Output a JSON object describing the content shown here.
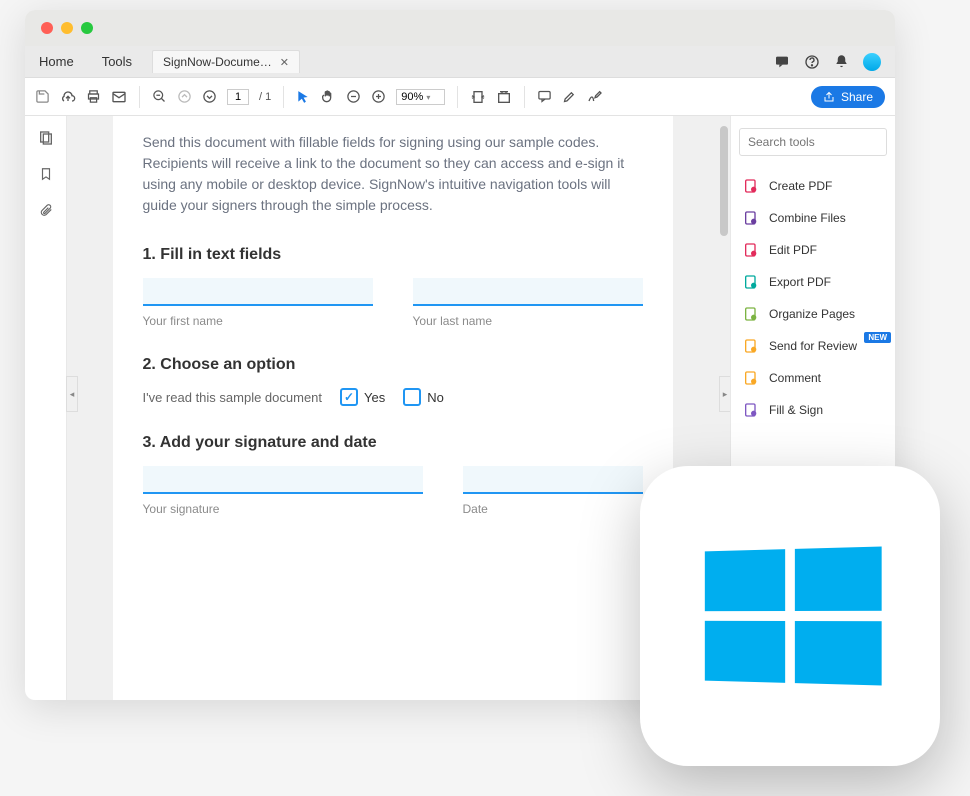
{
  "tabs": {
    "home": "Home",
    "tools": "Tools",
    "document": "SignNow-Docume…"
  },
  "toolbar": {
    "page_current": "1",
    "page_total": "/ 1",
    "zoom": "90%",
    "share": "Share"
  },
  "search": {
    "placeholder": "Search tools"
  },
  "tools_list": [
    {
      "label": "Create PDF",
      "color": "#e22b5b"
    },
    {
      "label": "Combine Files",
      "color": "#6b3fa0"
    },
    {
      "label": "Edit PDF",
      "color": "#e22b5b"
    },
    {
      "label": "Export PDF",
      "color": "#00a99d"
    },
    {
      "label": "Organize Pages",
      "color": "#7cb342"
    },
    {
      "label": "Send for Review",
      "color": "#f9a825",
      "badge": "NEW"
    },
    {
      "label": "Comment",
      "color": "#f9a825"
    },
    {
      "label": "Fill & Sign",
      "color": "#7e57c2"
    }
  ],
  "document": {
    "intro": "Send this document with fillable fields for signing using our sample codes. Recipients will receive a link to the document so they can access and e-sign it using any mobile or desktop device. SignNow's intuitive navigation tools will guide your signers through the simple process.",
    "section1": "1. Fill in text fields",
    "first_name_label": "Your first name",
    "last_name_label": "Your last name",
    "section2": "2. Choose an option",
    "consent_text": "I've read this sample document",
    "yes": "Yes",
    "no": "No",
    "section3": "3. Add your signature and date",
    "signature_label": "Your signature",
    "date_label": "Date"
  }
}
